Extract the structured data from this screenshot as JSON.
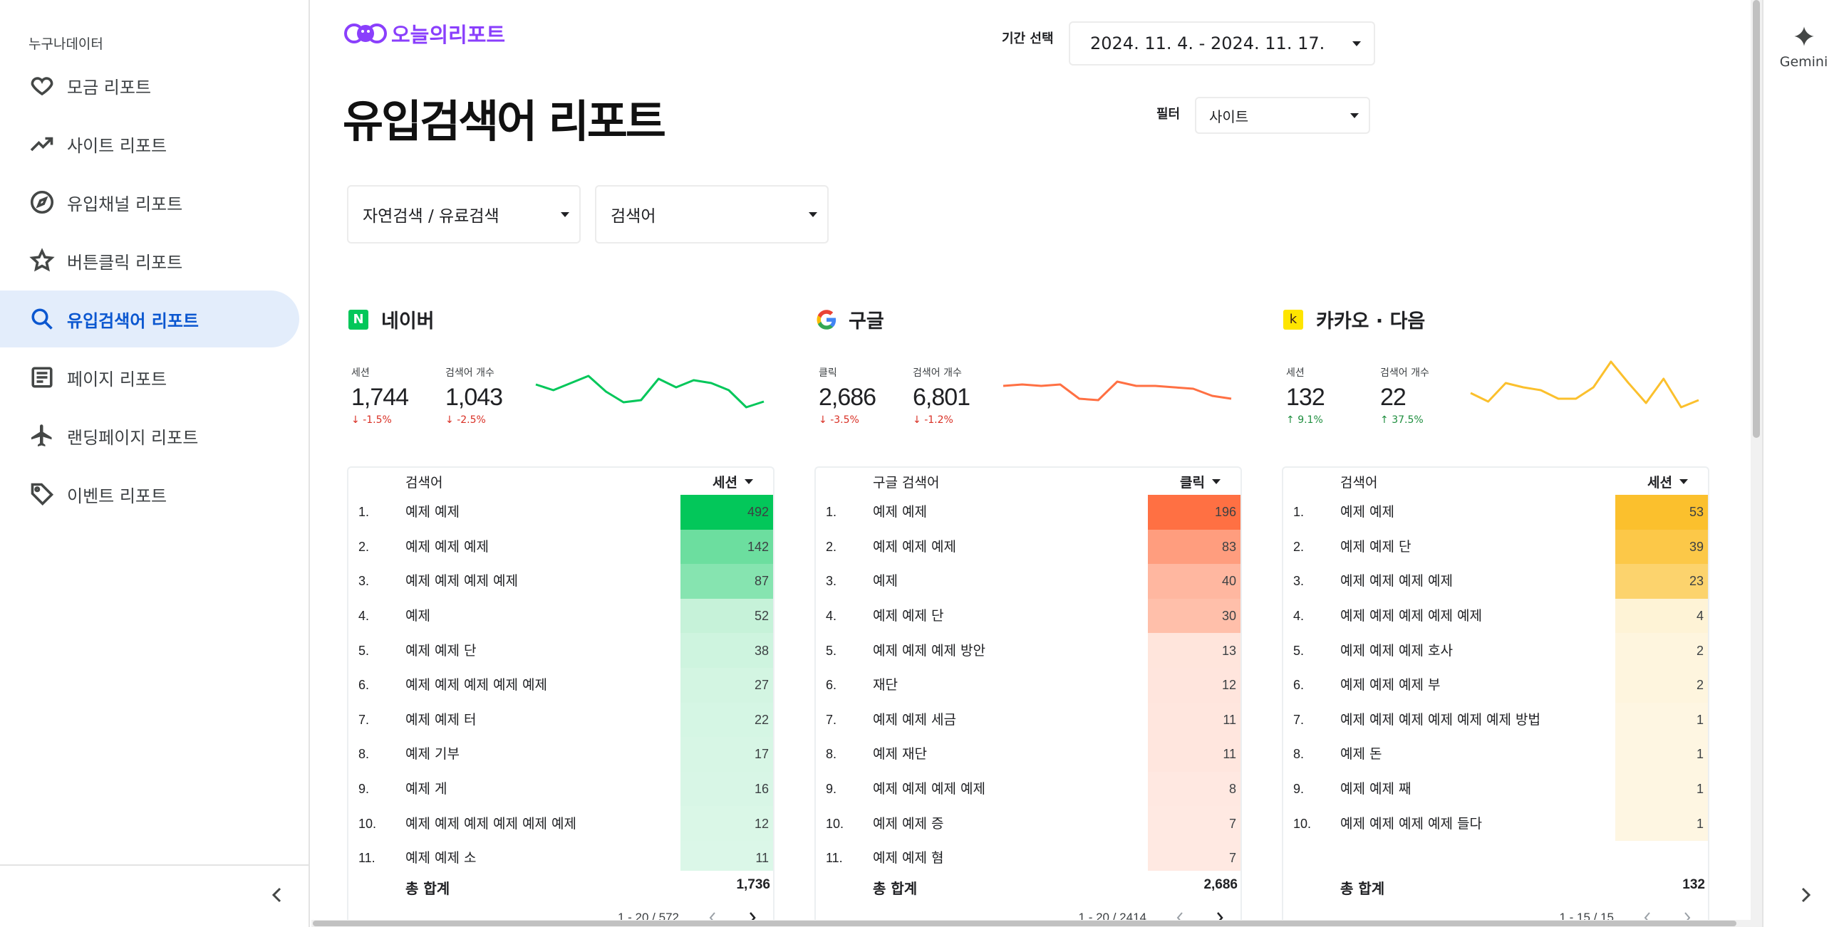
{
  "sidebar": {
    "brand": "누구나데이터",
    "items": [
      {
        "label": "모금 리포트",
        "icon": "heart-icon",
        "active": false
      },
      {
        "label": "사이트 리포트",
        "icon": "trending-up-icon",
        "active": false
      },
      {
        "label": "유입채널 리포트",
        "icon": "compass-icon",
        "active": false
      },
      {
        "label": "버튼클릭 리포트",
        "icon": "star-icon",
        "active": false
      },
      {
        "label": "유입검색어 리포트",
        "icon": "search-icon",
        "active": true
      },
      {
        "label": "페이지 리포트",
        "icon": "article-icon",
        "active": false
      },
      {
        "label": "랜딩페이지 리포트",
        "icon": "airplane-icon",
        "active": false
      },
      {
        "label": "이벤트 리포트",
        "icon": "tag-icon",
        "active": false
      }
    ],
    "collapse_icon": "chevron-left-icon"
  },
  "report": {
    "logo_text": "오늘의리포트",
    "title": "유입검색어 리포트",
    "date_label": "기간 선택",
    "date_value": "2024. 11. 4. - 2024. 11. 17.",
    "filter_label": "필터",
    "filter_value": "사이트",
    "search_type_value": "자연검색 / 유료검색",
    "dimension_value": "검색어"
  },
  "sections": [
    {
      "name": "네이버",
      "logo_letter": "N",
      "logo_color": "#03c75a",
      "accent": "#03c75a",
      "metric1": {
        "label": "세션",
        "value": "1,744",
        "delta": "-1.5%",
        "dir": "down"
      },
      "metric2": {
        "label": "검색어 개수",
        "value": "1,043",
        "delta": "-2.5%",
        "dir": "down"
      },
      "spark": [
        60,
        52,
        62,
        72,
        50,
        35,
        38,
        68,
        56,
        66,
        62,
        52,
        28,
        36
      ],
      "col_term": "검색어",
      "col_metric": "세션",
      "max": 492,
      "rows": [
        {
          "rank": "1.",
          "term": "예제 예제",
          "value": 492
        },
        {
          "rank": "2.",
          "term": "예제 예제 예제",
          "value": 142
        },
        {
          "rank": "3.",
          "term": "예제 예제 예제 예제",
          "value": 87
        },
        {
          "rank": "4.",
          "term": "예제",
          "value": 52
        },
        {
          "rank": "5.",
          "term": "예제 예제 단",
          "value": 38
        },
        {
          "rank": "6.",
          "term": "예제 예제 예제 예제 예제",
          "value": 27
        },
        {
          "rank": "7.",
          "term": "예제 예제 터",
          "value": 22
        },
        {
          "rank": "8.",
          "term": "예제 기부",
          "value": 17
        },
        {
          "rank": "9.",
          "term": "예제 게",
          "value": 16
        },
        {
          "rank": "10.",
          "term": "예제 예제 예제 예제 예제 예제",
          "value": 12
        },
        {
          "rank": "11.",
          "term": "예제 예제 소",
          "value": 11
        }
      ],
      "total_label": "총 합계",
      "total": "1,736",
      "pager": "1 - 20 / 572"
    },
    {
      "name": "구글",
      "logo_letter": "G",
      "logo_color": "#4285f4",
      "accent": "#ff7043",
      "metric1": {
        "label": "클릭",
        "value": "2,686",
        "delta": "-3.5%",
        "dir": "down"
      },
      "metric2": {
        "label": "검색어 개수",
        "value": "6,801",
        "delta": "-1.2%",
        "dir": "down"
      },
      "spark": [
        58,
        60,
        58,
        60,
        40,
        38,
        64,
        58,
        58,
        56,
        54,
        44,
        40
      ],
      "col_term": "구글 검색어",
      "col_metric": "클릭",
      "max": 196,
      "rows": [
        {
          "rank": "1.",
          "term": "예제 예제",
          "value": 196
        },
        {
          "rank": "2.",
          "term": "예제 예제 예제",
          "value": 83
        },
        {
          "rank": "3.",
          "term": "예제",
          "value": 40
        },
        {
          "rank": "4.",
          "term": "예제 예제 단",
          "value": 30
        },
        {
          "rank": "5.",
          "term": "예제 예제 예제 방안",
          "value": 13
        },
        {
          "rank": "6.",
          "term": "재단",
          "value": 12
        },
        {
          "rank": "7.",
          "term": "예제 예제 세금",
          "value": 11
        },
        {
          "rank": "8.",
          "term": "예제 재단",
          "value": 11
        },
        {
          "rank": "9.",
          "term": "예제 예제 예제 예제",
          "value": 8
        },
        {
          "rank": "10.",
          "term": "예제 예제 증",
          "value": 7
        },
        {
          "rank": "11.",
          "term": "예제 예제 혐",
          "value": 7
        }
      ],
      "total_label": "총 합계",
      "total": "2,686",
      "pager": "1 - 20 / 2414"
    },
    {
      "name": "카카오 · 다음",
      "logo_letter": "k",
      "logo_color": "#fee500",
      "accent": "#fbc02d",
      "metric1": {
        "label": "세션",
        "value": "132",
        "delta": "9.1%",
        "dir": "up"
      },
      "metric2": {
        "label": "검색어 개수",
        "value": "22",
        "delta": "37.5%",
        "dir": "up"
      },
      "spark": [
        48,
        36,
        62,
        56,
        52,
        40,
        40,
        56,
        92,
        62,
        34,
        68,
        28,
        38
      ],
      "col_term": "검색어",
      "col_metric": "세션",
      "max": 53,
      "rows": [
        {
          "rank": "1.",
          "term": "예제 예제",
          "value": 53
        },
        {
          "rank": "2.",
          "term": "예제 예제 단",
          "value": 39
        },
        {
          "rank": "3.",
          "term": "예제 예제 예제 예제",
          "value": 23
        },
        {
          "rank": "4.",
          "term": "예제 예제 예제 예제 예제",
          "value": 4
        },
        {
          "rank": "5.",
          "term": "예제 예제 예제 호사",
          "value": 2
        },
        {
          "rank": "6.",
          "term": "예제 예제 예제 부",
          "value": 2
        },
        {
          "rank": "7.",
          "term": "예제 예제 예제 예제 예제 예제 방법",
          "value": 1
        },
        {
          "rank": "8.",
          "term": "예제 돈",
          "value": 1
        },
        {
          "rank": "9.",
          "term": "예제 예제 째",
          "value": 1
        },
        {
          "rank": "10.",
          "term": "예제 예제 예제 예제 들다",
          "value": 1
        }
      ],
      "total_label": "총 합계",
      "total": "132",
      "pager": "1 - 15 / 15"
    }
  ],
  "rail": {
    "gemini_label": "Gemini",
    "expand_icon": "chevron-right-icon"
  }
}
